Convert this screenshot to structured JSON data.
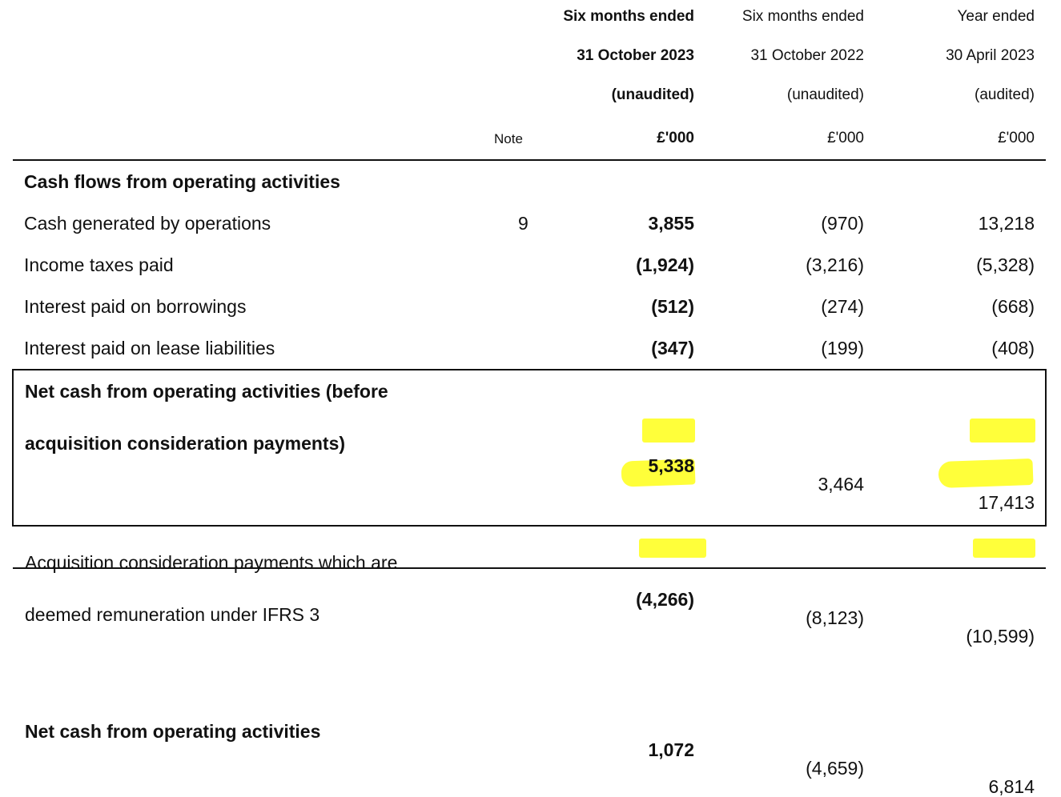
{
  "columns": [
    {
      "line1": "Six months ended",
      "line2": "31 October 2023",
      "line3": "(unaudited)",
      "unit": "£'000",
      "bold": true
    },
    {
      "line1": "Six months ended",
      "line2": "31 October 2022",
      "line3": "(unaudited)",
      "unit": "£'000",
      "bold": false
    },
    {
      "line1": "Year ended",
      "line2": "30 April 2023",
      "line3": "(audited)",
      "unit": "£'000",
      "bold": false
    }
  ],
  "note_header": "Note",
  "section_title": "Cash flows from operating activities",
  "rows": [
    {
      "label": "Cash generated by operations",
      "note": "9",
      "values": [
        "3,855",
        "(970)",
        "13,218"
      ]
    },
    {
      "label": "Income taxes paid",
      "note": "",
      "values": [
        "(1,924)",
        "(3,216)",
        "(5,328)"
      ]
    },
    {
      "label": "Interest paid on borrowings",
      "note": "",
      "values": [
        "(512)",
        "(274)",
        "(668)"
      ]
    },
    {
      "label": "Interest paid on lease liabilities",
      "note": "",
      "values": [
        "(347)",
        "(199)",
        "(408)"
      ]
    }
  ],
  "boxed": {
    "net_before": {
      "label_line1": "Net cash from operating activities (before",
      "label_line2": "acquisition consideration payments)",
      "values": [
        "5,338",
        "3,464",
        "17,413"
      ]
    },
    "acquisition": {
      "label_line1": "Acquisition consideration payments which are",
      "label_line2": "deemed remuneration under IFRS 3",
      "values": [
        "(4,266)",
        "(8,123)",
        "(10,599)"
      ]
    }
  },
  "total": {
    "label": "Net cash from operating activities",
    "values": [
      "1,072",
      "(4,659)",
      "6,814"
    ]
  },
  "highlight_color": "#ffff3a"
}
